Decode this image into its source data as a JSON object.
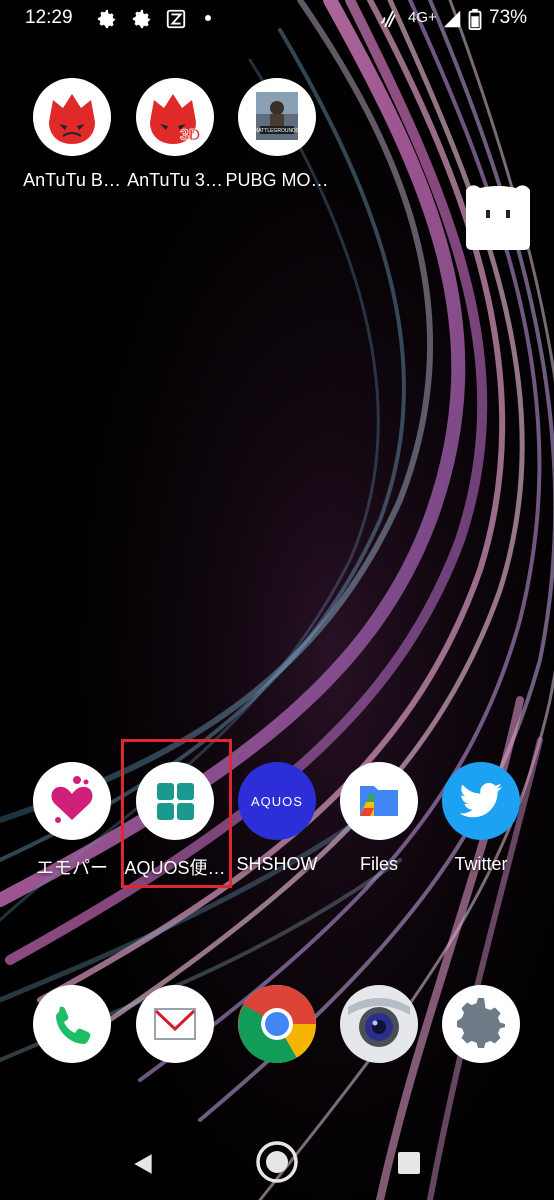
{
  "status_bar": {
    "time": "12:29",
    "network": "4G+",
    "battery": "73%",
    "icons": [
      "settings-icon",
      "settings-icon",
      "app-notification-icon",
      "dot",
      "nfc-icon",
      "signal-icon",
      "battery-icon"
    ]
  },
  "home_apps": [
    {
      "label": "AnTuTu B…",
      "icon": "antutu-icon"
    },
    {
      "label": "AnTuTu 3…",
      "icon": "antutu-3d-icon"
    },
    {
      "label": "PUBG MO…",
      "icon": "pubg-icon"
    }
  ],
  "dock_row_apps": [
    {
      "label": "エモパー",
      "icon": "emopa-heart-icon"
    },
    {
      "label": "AQUOS便…",
      "icon": "aquos-grid-icon"
    },
    {
      "label": "SHSHOW",
      "icon": "aquos-logo-icon",
      "logo_text": "AQUOS"
    },
    {
      "label": "Files",
      "icon": "files-icon"
    },
    {
      "label": "Twitter",
      "icon": "twitter-bird-icon"
    }
  ],
  "dock": [
    {
      "icon": "phone-icon"
    },
    {
      "icon": "mail-icon"
    },
    {
      "icon": "chrome-icon"
    },
    {
      "icon": "camera-icon"
    },
    {
      "icon": "settings-gear-icon"
    }
  ],
  "nav": {
    "icons": [
      "back-icon",
      "home-icon",
      "recents-icon"
    ]
  },
  "colors": {
    "highlight": "#e0262f",
    "antutu_red": "#e02a2a",
    "emopa_pink": "#d0207a",
    "aquos_teal": "#1a9a8f",
    "aquos_blue": "#2c2fd8",
    "twitter_blue": "#1da1f2"
  }
}
